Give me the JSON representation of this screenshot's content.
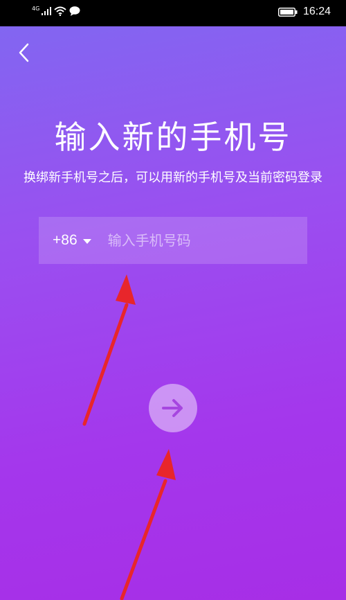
{
  "status_bar": {
    "network_type": "4G",
    "time": "16:24",
    "icons": [
      "signal-icon",
      "wifi-icon",
      "message-icon",
      "battery-icon"
    ]
  },
  "header": {
    "back_icon": "chevron-left-icon"
  },
  "main": {
    "title": "输入新的手机号",
    "subtitle": "换绑新手机号之后，可以用新的手机号及当前密码登录",
    "country_code": "+86",
    "phone_placeholder": "输入手机号码",
    "phone_value": "",
    "next_icon": "arrow-right-icon"
  },
  "colors": {
    "gradient_top": "#8266f1",
    "gradient_bottom": "#a72ee6",
    "arrow_icon_color": "#a646e0",
    "annotation_arrow": "#e8262b"
  }
}
